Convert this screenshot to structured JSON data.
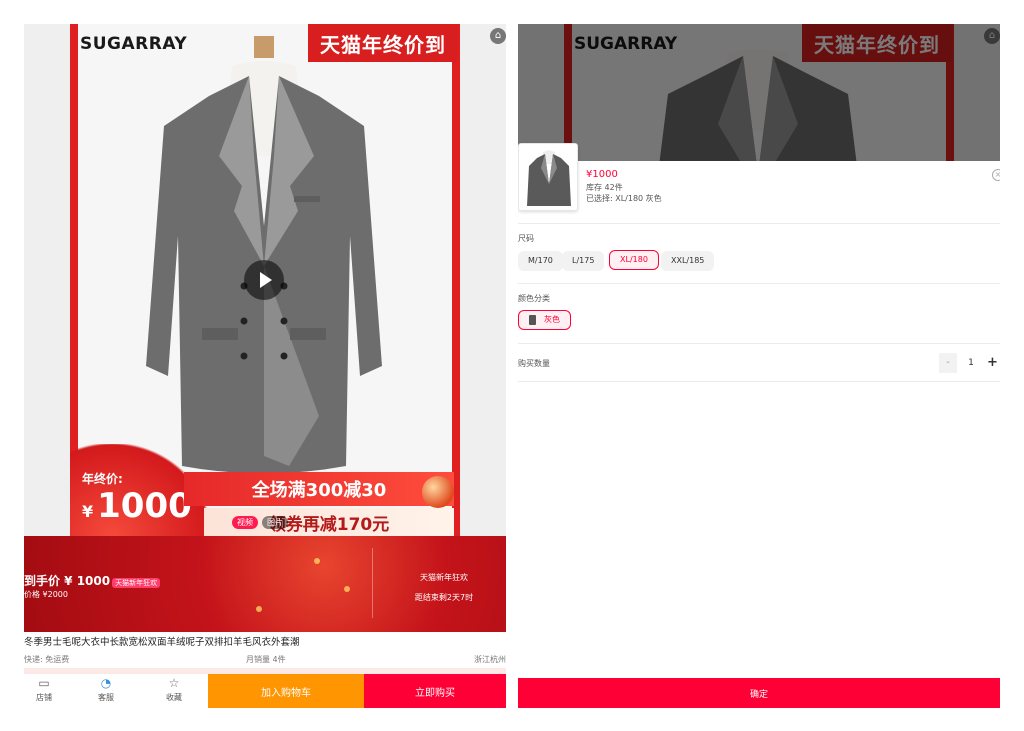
{
  "product": {
    "brand": "SUGARRAY",
    "promo_tag": "天猫年终价到",
    "cart_corner_icon": "cart-icon",
    "price_label": "年终价:",
    "currency": "¥",
    "price": "1000",
    "banner_full_reduction": "全场满300减30",
    "banner_coupon": "领券再减170元",
    "media_tabs": [
      "视频",
      "图片"
    ],
    "festival": {
      "price_line": "到手价 ¥ 1000",
      "badge": "天猫新年狂欢",
      "orig_price": "价格 ¥2000",
      "right_line1": "天猫新年狂欢",
      "right_line2": "距结束剩2天7时"
    },
    "title": "冬季男士毛呢大衣中长款宽松双面羊绒呢子双排扣羊毛风衣外套潮",
    "meta": {
      "shipping": "快递: 免运费",
      "monthly_sales": "月销量 4件",
      "location": "浙江杭州"
    }
  },
  "bottom_bar": {
    "shop_label": "店铺",
    "service_label": "客服",
    "favorite_label": "收藏",
    "add_to_cart": "加入购物车",
    "buy_now": "立即购买"
  },
  "sku_sheet": {
    "price": "¥1000",
    "stock": "库存 42件",
    "chosen": "已选择: XL/180  灰色",
    "size_label": "尺码",
    "sizes": [
      "M/170",
      "L/175",
      "XL/180",
      "XXL/185"
    ],
    "selected_size": "XL/180",
    "color_label": "颜色分类",
    "colors": [
      "灰色"
    ],
    "selected_color": "灰色",
    "quantity_label": "购买数量",
    "quantity": "1",
    "minus": "-",
    "plus": "+",
    "confirm": "确定"
  },
  "colors": {
    "accent_red": "#ff0036",
    "cart_orange": "#ff9500",
    "promo_red": "#d81e1e"
  }
}
